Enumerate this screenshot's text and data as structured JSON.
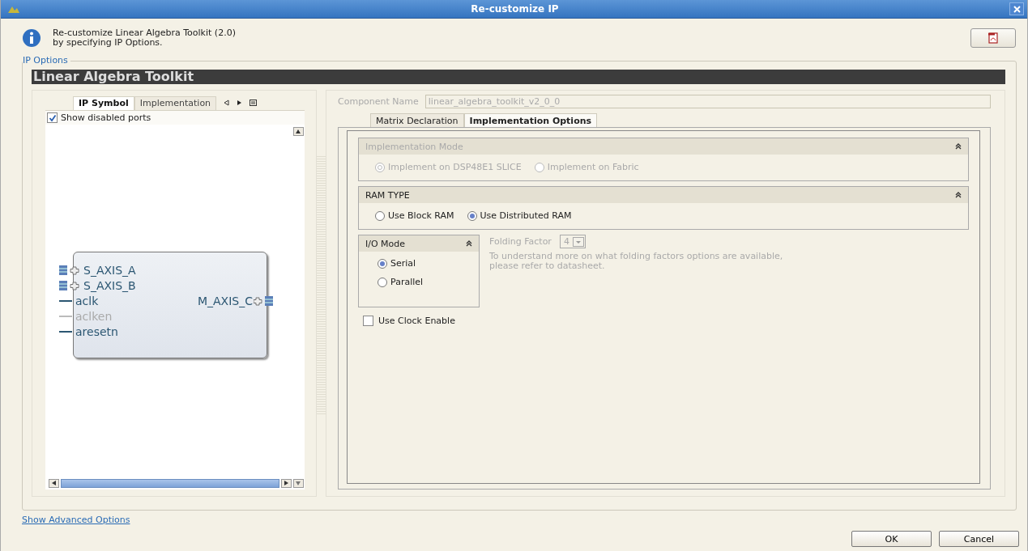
{
  "window": {
    "title": "Re-customize IP"
  },
  "header": {
    "message": "Re-customize Linear Algebra Toolkit (2.0)\nby specifying IP Options."
  },
  "ip_options": {
    "legend": "IP Options",
    "banner": "Linear Algebra Toolkit",
    "left_tabs": [
      {
        "label": "IP Symbol",
        "selected": true
      },
      {
        "label": "Implementation",
        "selected": false
      }
    ],
    "show_disabled_ports": {
      "label": "Show disabled ports",
      "checked": true
    },
    "symbol": {
      "inputs": [
        {
          "name": "S_AXIS_A",
          "kind": "bus",
          "disabled": false
        },
        {
          "name": "S_AXIS_B",
          "kind": "bus",
          "disabled": false
        },
        {
          "name": "aclk",
          "kind": "wire",
          "disabled": false
        },
        {
          "name": "aclken",
          "kind": "wire",
          "disabled": true
        },
        {
          "name": "aresetn",
          "kind": "wire",
          "disabled": false
        }
      ],
      "outputs": [
        {
          "name": "M_AXIS_C",
          "kind": "bus",
          "disabled": false
        }
      ]
    },
    "component_name": {
      "label": "Component Name",
      "value": "linear_algebra_toolkit_v2_0_0",
      "disabled": true
    },
    "right_tabs": [
      {
        "label": "Matrix Declaration",
        "selected": false
      },
      {
        "label": "Implementation Options",
        "selected": true
      }
    ],
    "sections": [
      {
        "title": "Implementation Mode",
        "disabled": true,
        "options": [
          {
            "label": "Implement on DSP48E1 SLICE",
            "selected": true
          },
          {
            "label": "Implement on Fabric",
            "selected": false
          }
        ]
      },
      {
        "title": "RAM TYPE",
        "disabled": false,
        "options": [
          {
            "label": "Use Block RAM",
            "selected": false
          },
          {
            "label": "Use Distributed RAM",
            "selected": true
          }
        ]
      }
    ],
    "io_mode": {
      "title": "I/O Mode",
      "options": [
        {
          "label": "Serial",
          "selected": true
        },
        {
          "label": "Parallel",
          "selected": false
        }
      ]
    },
    "folding_factor": {
      "label": "Folding Factor",
      "value": "4",
      "disabled": true,
      "note": "To understand more on what folding factors options are available,\nplease refer to datasheet."
    },
    "use_clock_enable": {
      "label": "Use Clock Enable",
      "checked": false
    }
  },
  "footer": {
    "link": "Show Advanced Options",
    "buttons": [
      "OK",
      "Cancel"
    ]
  }
}
